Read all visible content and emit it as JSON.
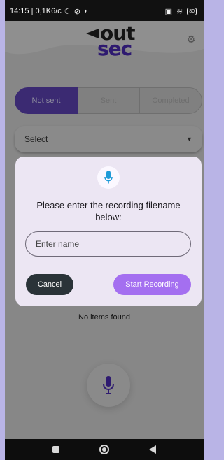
{
  "status": {
    "left_text": "14:15 | 0,1K6/c",
    "battery": "80"
  },
  "app": {
    "logo_top": "out",
    "logo_bottom": "sec"
  },
  "tabs": [
    {
      "label": "Not sent"
    },
    {
      "label": "Sent"
    },
    {
      "label": "Completed"
    }
  ],
  "select": {
    "label": "Select"
  },
  "list": {
    "empty_text": "No items found"
  },
  "dialog": {
    "message": "Please enter the recording filename below:",
    "input_placeholder": "Enter name",
    "input_value": "",
    "cancel_label": "Cancel",
    "start_label": "Start Recording"
  },
  "colors": {
    "accent": "#a46ff0",
    "tab_active": "#3b2a72",
    "mic_blue": "#1e9bd7",
    "mic_purple": "#2e1a70",
    "cancel_bg": "#2a3338"
  },
  "icons": {
    "status": [
      "night-mode-icon",
      "data-saver-icon",
      "vpn-icon",
      "sim-icon",
      "wifi-icon",
      "battery-icon"
    ],
    "settings": "gear-icon",
    "dialog": "microphone-icon",
    "fab": "microphone-icon",
    "nav": [
      "recents-icon",
      "home-icon",
      "back-icon"
    ]
  }
}
